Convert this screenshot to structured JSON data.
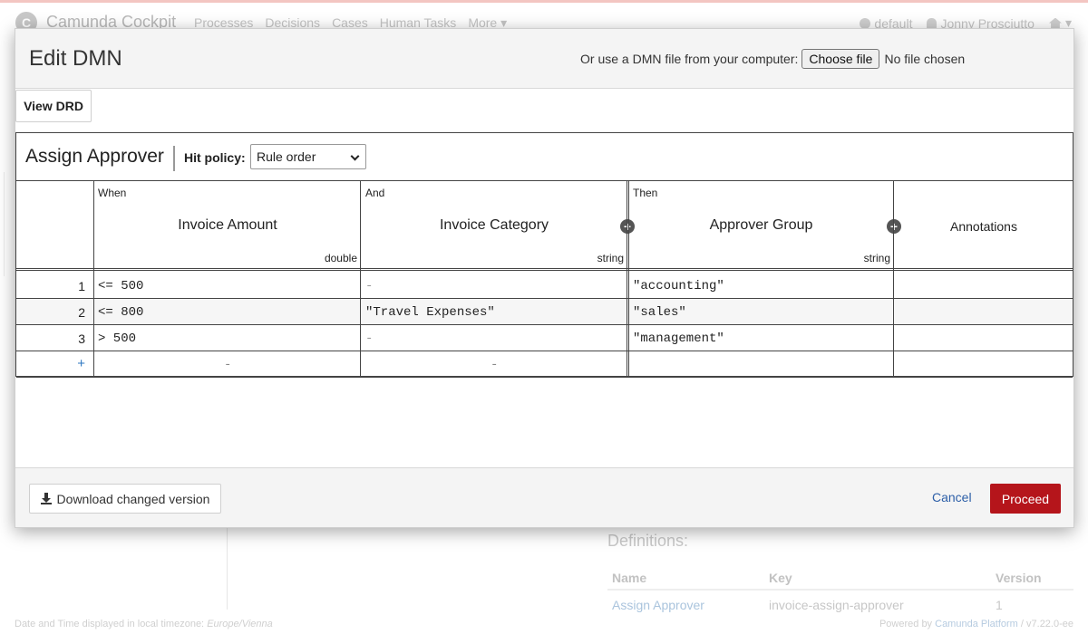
{
  "background": {
    "brand": "Camunda Cockpit",
    "brand_logo": "C",
    "nav": [
      "Processes",
      "Decisions",
      "Cases",
      "Human Tasks",
      "More"
    ],
    "engine": "default",
    "user": "Jonny Prosciutto",
    "definitions_title": "Definitions:",
    "table_headers": [
      "Name",
      "Key",
      "Version"
    ],
    "table_row": [
      "Assign Approver",
      "invoice-assign-approver",
      "1"
    ],
    "footer_left_prefix": "Date and Time displayed in local timezone:",
    "footer_left_tz": "Europe/Vienna",
    "footer_right_prefix": "Powered by",
    "footer_right_link": "Camunda Platform",
    "footer_right_version": "/ v7.22.0-ee"
  },
  "modal": {
    "title": "Edit DMN",
    "upload_label": "Or use a DMN file from your computer:",
    "choose_file": "Choose file",
    "no_file": "No file chosen",
    "view_drd": "View DRD",
    "decision_name": "Assign Approver",
    "hit_policy_label": "Hit policy:",
    "hit_policy_value": "Rule order",
    "clauses": {
      "when": "When",
      "and": "And",
      "then": "Then"
    },
    "columns": {
      "input1": {
        "label": "Invoice Amount",
        "type": "double"
      },
      "input2": {
        "label": "Invoice Category",
        "type": "string"
      },
      "output1": {
        "label": "Approver Group",
        "type": "string"
      },
      "annotations": "Annotations"
    },
    "rules": [
      {
        "index": "1",
        "in1": "<= 500",
        "in2": "-",
        "out": "\"accounting\""
      },
      {
        "index": "2",
        "in1": "<= 800",
        "in2": "\"Travel Expenses\"",
        "out": "\"sales\""
      },
      {
        "index": "3",
        "in1": "> 500",
        "in2": "-",
        "out": "\"management\""
      }
    ],
    "add_rule": "+",
    "empty_dash": "-",
    "download": "Download changed version",
    "cancel": "Cancel",
    "proceed": "Proceed"
  },
  "colors": {
    "primary": "#b5151b",
    "link": "#2d5fa8"
  }
}
